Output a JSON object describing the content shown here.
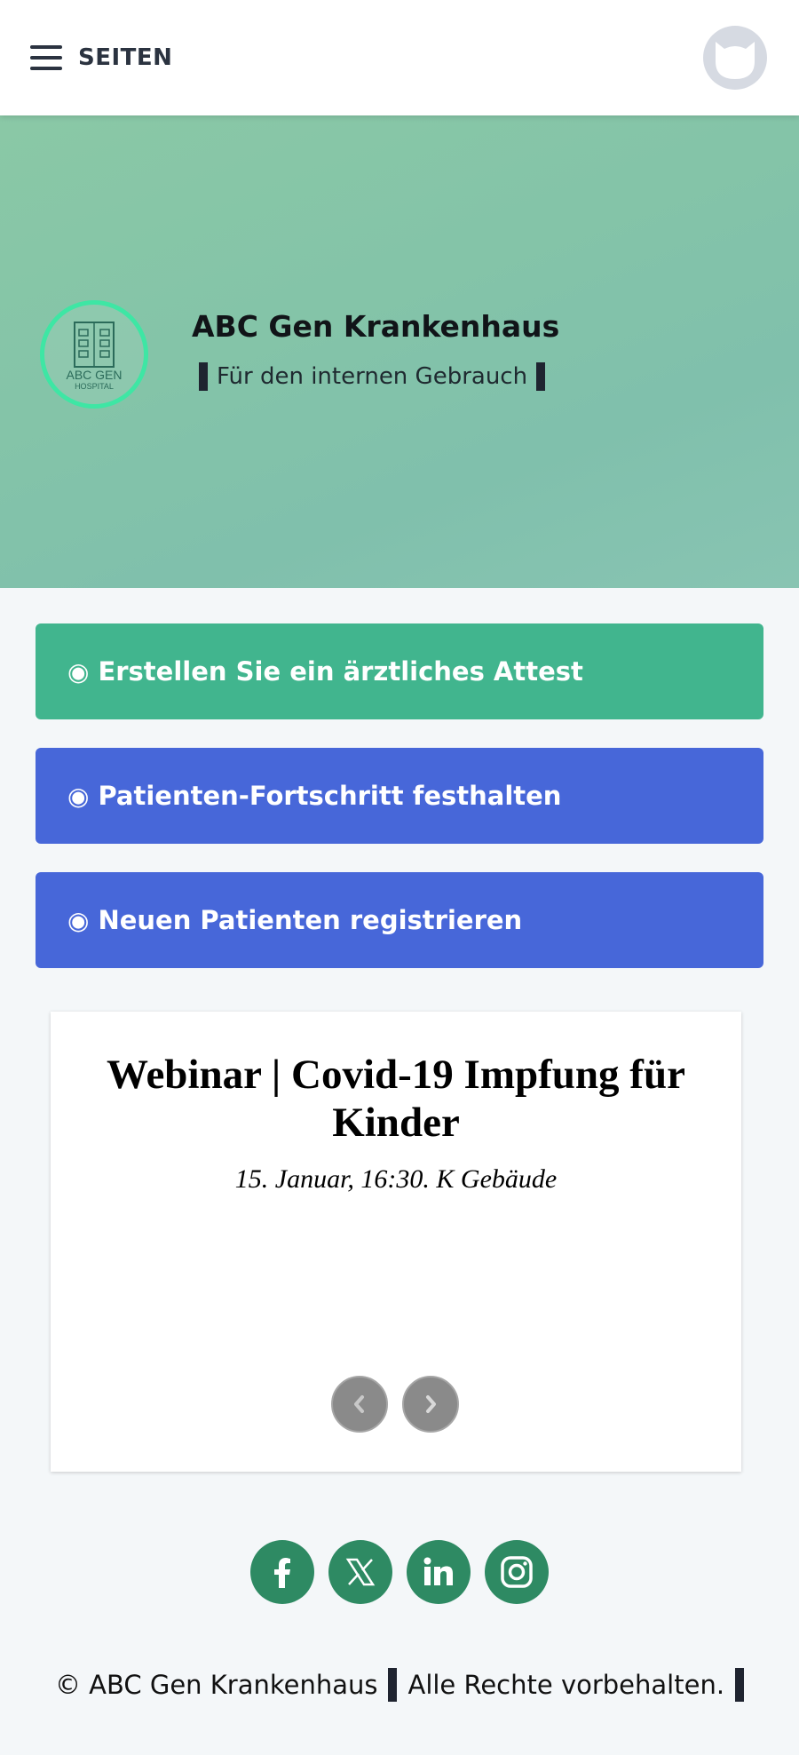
{
  "header": {
    "menu_label": "SEITEN",
    "avatar_icon": "avatar-icon"
  },
  "hero": {
    "title": "ABC Gen Krankenhaus",
    "tagline": "Für den internen Gebrauch",
    "logo_text_line1": "ABC GEN",
    "logo_text_line2": "HOSPITAL",
    "logo_color": "#3ee6a4"
  },
  "actions": [
    {
      "label": "Erstellen Sie ein ärztliches Attest",
      "color": "#41b58e"
    },
    {
      "label": "Patienten-Fortschritt festhalten",
      "color": "#4767d9"
    },
    {
      "label": "Neuen Patienten registrieren",
      "color": "#4767d9"
    }
  ],
  "carousel": {
    "title": "Webinar | Covid-19 Impfung für Kinder",
    "subtitle": "15. Januar, 16:30. K Gebäude"
  },
  "social": [
    "facebook-icon",
    "x-twitter-icon",
    "linkedin-icon",
    "instagram-icon"
  ],
  "footer": {
    "copyright": "© ABC Gen Krankenhaus",
    "rights": "Alle Rechte vorbehalten."
  }
}
